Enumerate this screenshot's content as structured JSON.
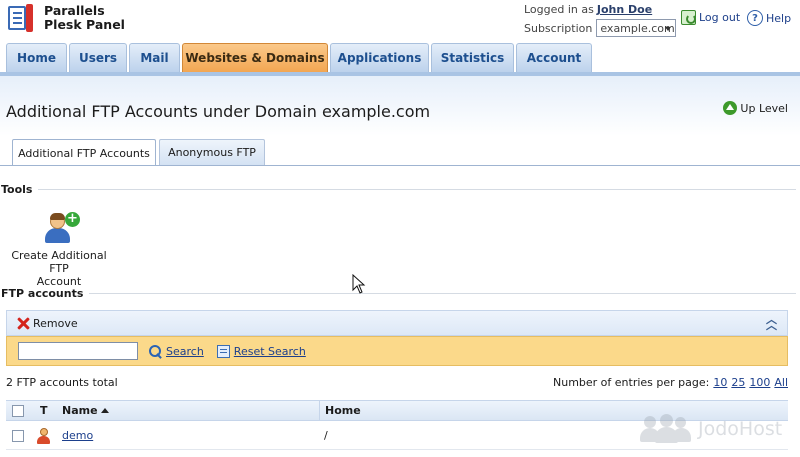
{
  "header": {
    "brand_line1": "Parallels",
    "brand_line2": "Plesk Panel",
    "logged_in_label": "Logged in as",
    "user_name": "John Doe",
    "subscription_label": "Subscription",
    "subscription_value": "example.com",
    "logout_label": "Log out",
    "help_label": "Help"
  },
  "nav": {
    "tabs": [
      {
        "label": "Home"
      },
      {
        "label": "Users"
      },
      {
        "label": "Mail"
      },
      {
        "label": "Websites & Domains",
        "active": true
      },
      {
        "label": "Applications"
      },
      {
        "label": "Statistics"
      },
      {
        "label": "Account"
      }
    ]
  },
  "page": {
    "title": "Additional FTP Accounts under Domain example.com",
    "up_level": "Up Level",
    "sub_tabs": [
      {
        "label": "Additional FTP Accounts",
        "active": true
      },
      {
        "label": "Anonymous FTP"
      }
    ]
  },
  "tools": {
    "heading": "Tools",
    "create_label_line1": "Create Additional FTP",
    "create_label_line2": "Account"
  },
  "ftp": {
    "heading": "FTP accounts",
    "remove_label": "Remove",
    "search_value": "",
    "search_label": "Search",
    "reset_label": "Reset Search",
    "total_text": "2 FTP accounts total",
    "per_page_label": "Number of entries per page:",
    "per_page_options": [
      "10",
      "25",
      "100",
      "All"
    ],
    "columns": {
      "type": "T",
      "name": "Name",
      "home": "Home"
    },
    "rows": [
      {
        "name": "demo",
        "home": "/"
      }
    ]
  },
  "watermark": {
    "text": "JodoHost"
  },
  "colors": {
    "active_tab": "#f2a652",
    "nav_tab": "#bcd2ec",
    "search_bar": "#fbd98a",
    "link": "#1c3f8c"
  }
}
